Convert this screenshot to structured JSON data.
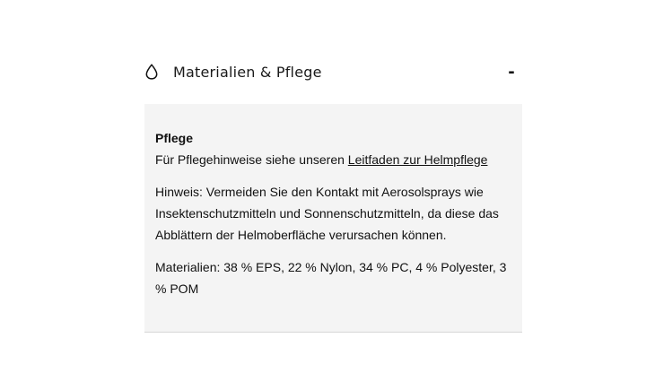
{
  "accordion": {
    "title": "Materialien & Pflege",
    "toggle": "-",
    "icon": "droplet-icon"
  },
  "care": {
    "heading": "Pflege",
    "intro": "Für Pflegehinweise siehe unseren ",
    "link_label": "Leitfaden zur Helmpflege"
  },
  "notice": "Hinweis: Vermeiden Sie den Kontakt mit Aerosolsprays wie Insektenschutzmitteln und Sonnenschutzmitteln, da diese das Abblättern der Helmoberfläche verursachen können.",
  "materials": "Materialien: 38 % EPS, 22 % Nylon, 34 % PC, 4 % Polyester, 3 % POM"
}
